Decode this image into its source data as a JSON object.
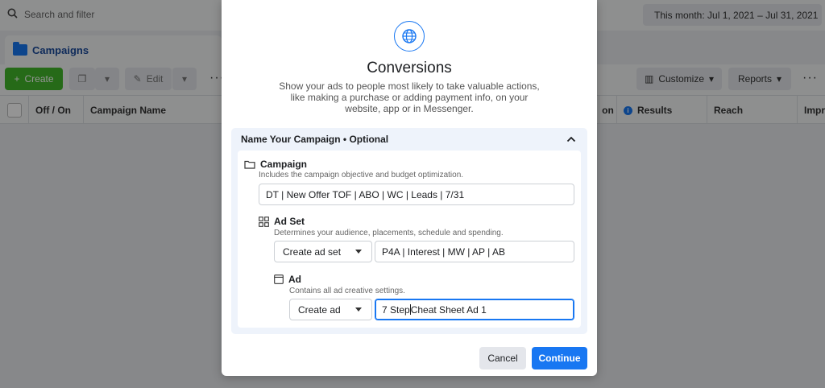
{
  "topbar": {
    "search_placeholder": "Search and filter",
    "date_range": "This month: Jul 1, 2021 – Jul 31, 2021"
  },
  "tabs": {
    "campaigns": "Campaigns"
  },
  "toolbar": {
    "create_label": "Create",
    "edit_label": "Edit",
    "customize_label": "Customize",
    "reports_label": "Reports",
    "more": "···"
  },
  "table": {
    "columns": [
      "Off / On",
      "Campaign Name",
      "on",
      "Results",
      "Reach",
      "Impr"
    ]
  },
  "modal": {
    "title": "Conversions",
    "description": "Show your ads to people most likely to take valuable actions, like making a purchase or adding payment info, on your website, app or in Messenger.",
    "section_title": "Name Your Campaign • Optional",
    "campaign": {
      "title": "Campaign",
      "desc": "Includes the campaign objective and budget optimization.",
      "value": "DT | New Offer TOF | ABO | WC | Leads | 7/31"
    },
    "adset": {
      "title": "Ad Set",
      "desc": "Determines your audience, placements, schedule and spending.",
      "select": "Create ad set",
      "value": "P4A | Interest | MW | AP | AB"
    },
    "ad": {
      "title": "Ad",
      "desc": "Contains all ad creative settings.",
      "select": "Create ad",
      "value_before_caret": "7 Step",
      "value_after_caret": "Cheat Sheet Ad 1"
    },
    "cancel_label": "Cancel",
    "continue_label": "Continue"
  },
  "colors": {
    "primary": "#1877f2",
    "create_green": "#42b72a",
    "section_bg": "#eef3fb"
  }
}
